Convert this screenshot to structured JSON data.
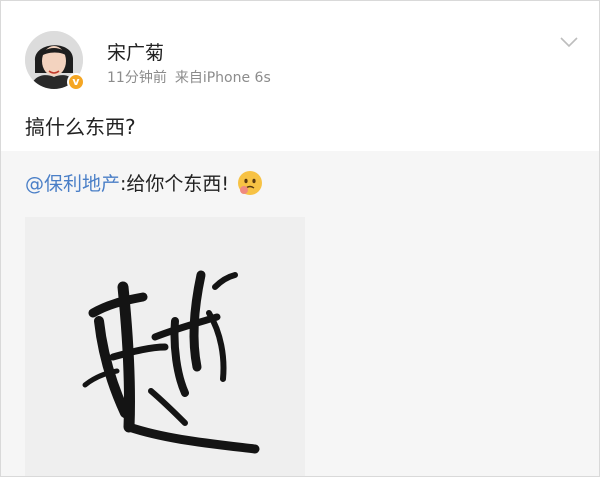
{
  "post": {
    "author": "宋广菊",
    "time": "11分钟前",
    "source": "来自iPhone 6s",
    "text": "搞什么东西?"
  },
  "repost": {
    "mention": "@保利地产",
    "text": ":给你个东西!",
    "emoji": "thinking-face-icon"
  },
  "colors": {
    "mention": "#4a7fc7",
    "verified_badge": "#f5a623",
    "repost_background": "#f6f6f6"
  }
}
